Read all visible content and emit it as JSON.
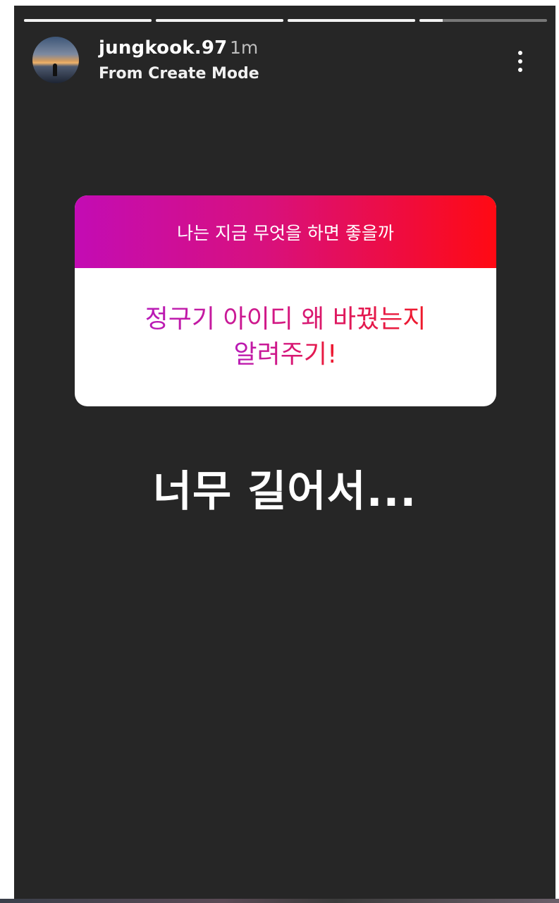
{
  "story": {
    "progress": [
      1,
      1,
      1,
      0.18
    ],
    "header": {
      "username": "jungkook.97",
      "time_ago": "1m",
      "subtitle": "From Create Mode",
      "avatar_icon": "profile-avatar-sunset"
    },
    "question_sticker": {
      "question": "나는 지금 무엇을 하면 좋을까",
      "answer_line1": "정구기 아이디 왜 바꿨는지",
      "answer_line2": "알려주기!",
      "colors": {
        "gradient_start": "#c30cb4",
        "gradient_end": "#ff0a13"
      }
    },
    "caption": "너무 길어서...",
    "more_icon": "more-vertical-icon"
  }
}
